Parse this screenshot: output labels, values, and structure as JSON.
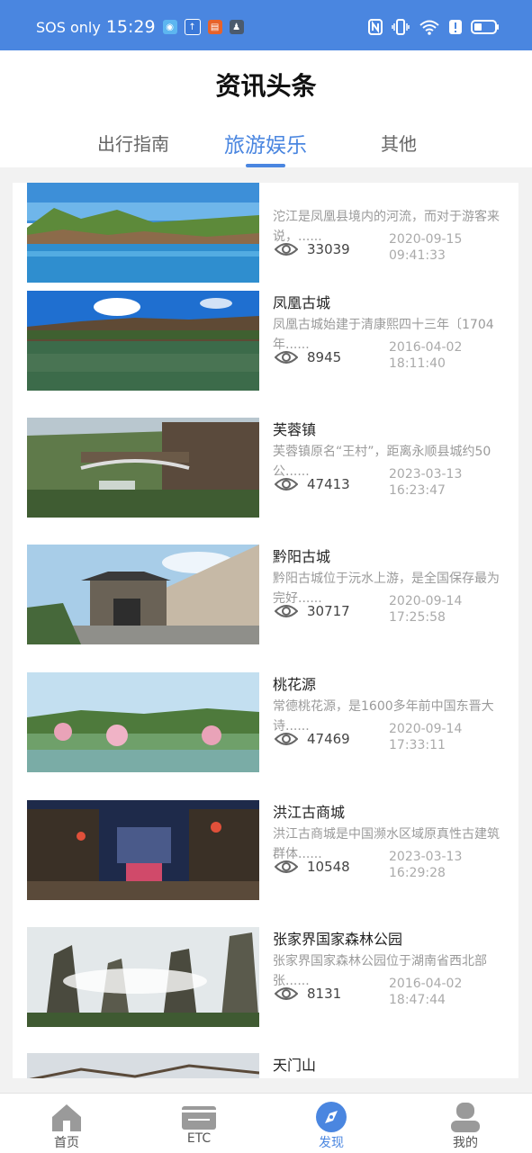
{
  "status_bar": {
    "sos": "SOS only",
    "time": "15:29",
    "colors": {
      "background": "#4a86e0"
    }
  },
  "header": {
    "title": "资讯头条",
    "tabs": [
      {
        "label": "出行指南",
        "active": false
      },
      {
        "label": "旅游娱乐",
        "active": true
      },
      {
        "label": "其他",
        "active": false
      }
    ],
    "accent_color": "#4a86e0"
  },
  "articles": [
    {
      "title": "",
      "desc": "沱江是凤凰县境内的河流，而对于游客来说，......",
      "views": "33039",
      "date": "2020-09-15",
      "time": "09:41:33",
      "image": "river-town"
    },
    {
      "title": "凤凰古城",
      "desc": "凤凰古城始建于清康熙四十三年〔1704年......",
      "views": "8945",
      "date": "2016-04-02",
      "time": "18:11:40",
      "image": "old-town-river"
    },
    {
      "title": "芙蓉镇",
      "desc": "芙蓉镇原名“王村”，距离永顺县城约50公......",
      "views": "47413",
      "date": "2023-03-13",
      "time": "16:23:47",
      "image": "waterfall-town"
    },
    {
      "title": "黔阳古城",
      "desc": "黔阳古城位于沅水上游，是全国保存最为完好......",
      "views": "30717",
      "date": "2020-09-14",
      "time": "17:25:58",
      "image": "ancient-wall"
    },
    {
      "title": "桃花源",
      "desc": "常德桃花源，是1600多年前中国东晋大诗......",
      "views": "47469",
      "date": "2020-09-14",
      "time": "17:33:11",
      "image": "peach-blossom"
    },
    {
      "title": "洪江古商城",
      "desc": "洪江古商城是中国濒水区域原真性古建筑群体......",
      "views": "10548",
      "date": "2023-03-13",
      "time": "16:29:28",
      "image": "night-street"
    },
    {
      "title": "张家界国家森林公园",
      "desc": "  张家界国家森林公园位于湖南省西北部张......",
      "views": "8131",
      "date": "2016-04-02",
      "time": "18:47:44",
      "image": "karst-peaks"
    },
    {
      "title": "天门山",
      "desc": "",
      "views": "",
      "date": "",
      "time": "",
      "image": "mountain-sky"
    }
  ],
  "bottom_nav": [
    {
      "label": "首页",
      "icon": "home-icon",
      "active": false
    },
    {
      "label": "ETC",
      "icon": "etc-card-icon",
      "active": false
    },
    {
      "label": "发现",
      "icon": "compass-icon",
      "active": true
    },
    {
      "label": "我的",
      "icon": "user-icon",
      "active": false
    }
  ]
}
